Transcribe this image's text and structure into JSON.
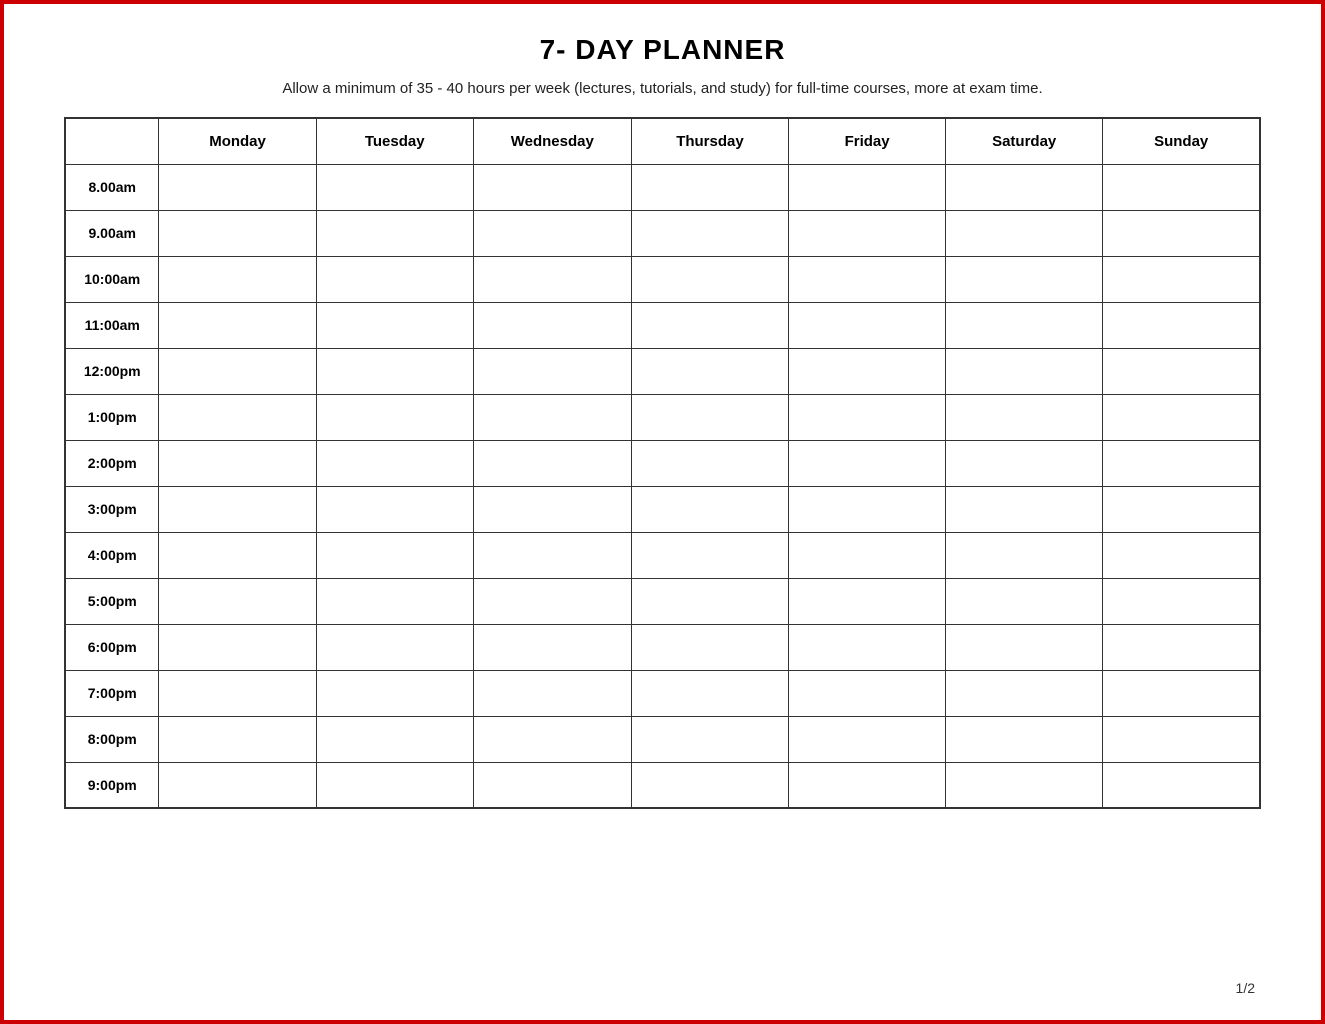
{
  "title": "7- DAY PLANNER",
  "subtitle": "Allow a minimum of 35 - 40 hours per week (lectures, tutorials, and study) for full-time courses, more at exam time.",
  "page_number": "1/2",
  "days": [
    "Monday",
    "Tuesday",
    "Wednesday",
    "Thursday",
    "Friday",
    "Saturday",
    "Sunday"
  ],
  "time_slots": [
    "8.00am",
    "9.00am",
    "10:00am",
    "11:00am",
    "12:00pm",
    "1:00pm",
    "2:00pm",
    "3:00pm",
    "4:00pm",
    "5:00pm",
    "6:00pm",
    "7:00pm",
    "8:00pm",
    "9:00pm"
  ]
}
